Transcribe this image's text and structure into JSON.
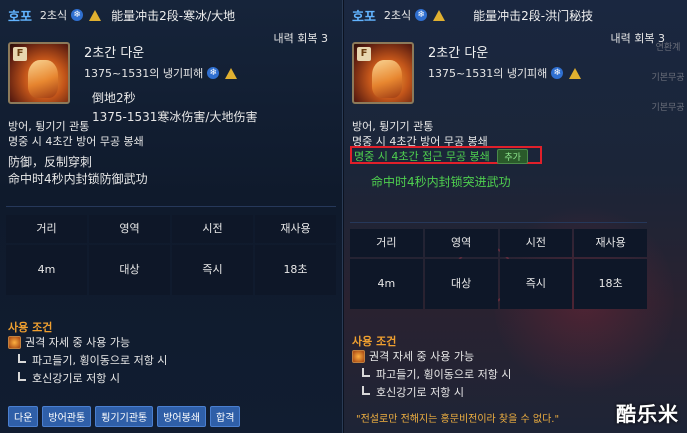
{
  "left": {
    "skill_name": "호포",
    "stage": "2초식",
    "cn_title": "能量冲击2段-寒冰/大地",
    "mp": "내력 회복 3",
    "down": "2초간 다운",
    "damage": "1375~1531의 냉기피해",
    "cn_down": "倒地2秒",
    "cn_damage": "1375-1531寒冰伤害/大地伤害",
    "desc1": "방어, 튕기기 관통",
    "desc2": "명중 시 4초간 방어 무공 봉쇄",
    "cn_desc1": "防御，反制穿刺",
    "cn_desc2": "命中时4秒内封锁防御武功",
    "stats_headers": [
      "거리",
      "영역",
      "시전",
      "재사용"
    ],
    "stats_values": [
      "4m",
      "대상",
      "즉시",
      "18초"
    ],
    "cond_title": "사용 조건",
    "cond_main": "권격 자세 중 사용 가능",
    "cond_sub1": "파고들기, 횡이동으로 저항 시",
    "cond_sub2": "호신강기로 저항 시",
    "tags": [
      "다운",
      "방어관통",
      "튕기기관통",
      "방어봉쇄",
      "합격"
    ]
  },
  "right": {
    "skill_name": "호포",
    "stage": "2초식",
    "cn_title": "能量冲击2段-洪门秘技",
    "mp": "내력 회복 3",
    "down": "2초간 다운",
    "damage": "1375~1531의 냉기피해",
    "desc1": "방어, 튕기기 관통",
    "desc2": "명중 시 4초간 방어 무공 봉쇄",
    "desc3": "명중 시 4초간 접근 무공 봉쇄",
    "add_badge": "추가",
    "cn_desc": "命中时4秒内封锁突进武功",
    "stats_headers": [
      "거리",
      "영역",
      "시전",
      "재사용"
    ],
    "stats_values": [
      "4m",
      "대상",
      "즉시",
      "18초"
    ],
    "cond_title": "사용 조건",
    "cond_main": "권격 자세 중 사용 가능",
    "cond_sub1": "파고들기, 횡이동으로 저항 시",
    "cond_sub2": "호신강기로 저항 시",
    "quote": "\"전설로만 전해지는 홍문비전이라 찾을 수 없다.\"",
    "side_labels": [
      "기본무공",
      "기본무공",
      "연환계"
    ]
  },
  "skill_icon_letter": "F",
  "watermark": "酷乐米",
  "colors": {
    "name_blue": "#62b4ff",
    "cond_orange": "#f0a030",
    "green": "#4fd04f",
    "highlight_red": "#e0202a",
    "tag_blue": "#2f5fa8"
  }
}
